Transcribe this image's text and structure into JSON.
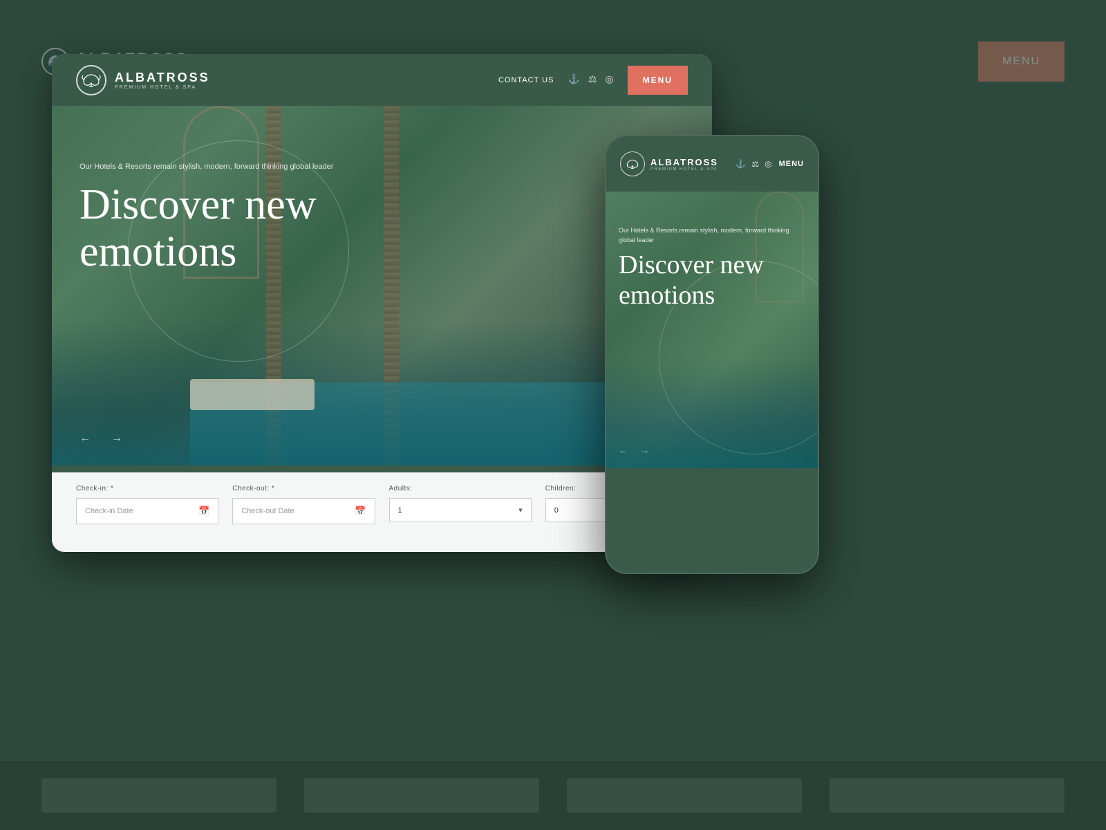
{
  "brand": {
    "name": "ALBATROSS",
    "tagline": "PREMIUM HOTEL & SPA",
    "logo_symbol": "🦅"
  },
  "desktop_nav": {
    "contact_label": "CONTACT US",
    "menu_label": "MENU",
    "social_icons": [
      "foursquare",
      "tripadvisor",
      "instagram"
    ]
  },
  "mobile_nav": {
    "menu_label": "MENU"
  },
  "hero": {
    "subtitle": "Our Hotels & Resorts remain stylish,\nmodern, forward thinking global leader",
    "title_line1": "Discover new",
    "title_line2": "emotions"
  },
  "booking": {
    "checkin_label": "Check-in: *",
    "checkin_placeholder": "Check-in Date",
    "checkout_label": "Check-out: *",
    "checkout_placeholder": "Check-out Date",
    "adults_label": "Adults:",
    "adults_value": "1",
    "children_label": "Children:",
    "children_value": "0"
  },
  "colors": {
    "primary_green": "#3a5a4a",
    "accent_salmon": "#e07060",
    "bg_dark": "#2d4a3e"
  },
  "arrows": {
    "left": "←",
    "right": "→"
  }
}
